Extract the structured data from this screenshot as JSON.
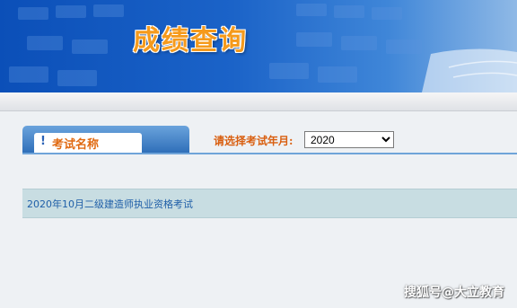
{
  "banner": {
    "title": "成绩查询"
  },
  "tab": {
    "icon": "exclamation-icon",
    "label": "考试名称"
  },
  "filter": {
    "label": "请选择考试年月:",
    "selected_year": "2020"
  },
  "exams": [
    {
      "name": "2020年10月二级建造师执业资格考试"
    }
  ],
  "watermark": {
    "text": "搜狐号@大立教育"
  },
  "colors": {
    "accent_orange": "#e06a12",
    "banner_blue": "#1b63c8",
    "row_bg": "#c8dde2",
    "link": "#1f5fa8"
  }
}
